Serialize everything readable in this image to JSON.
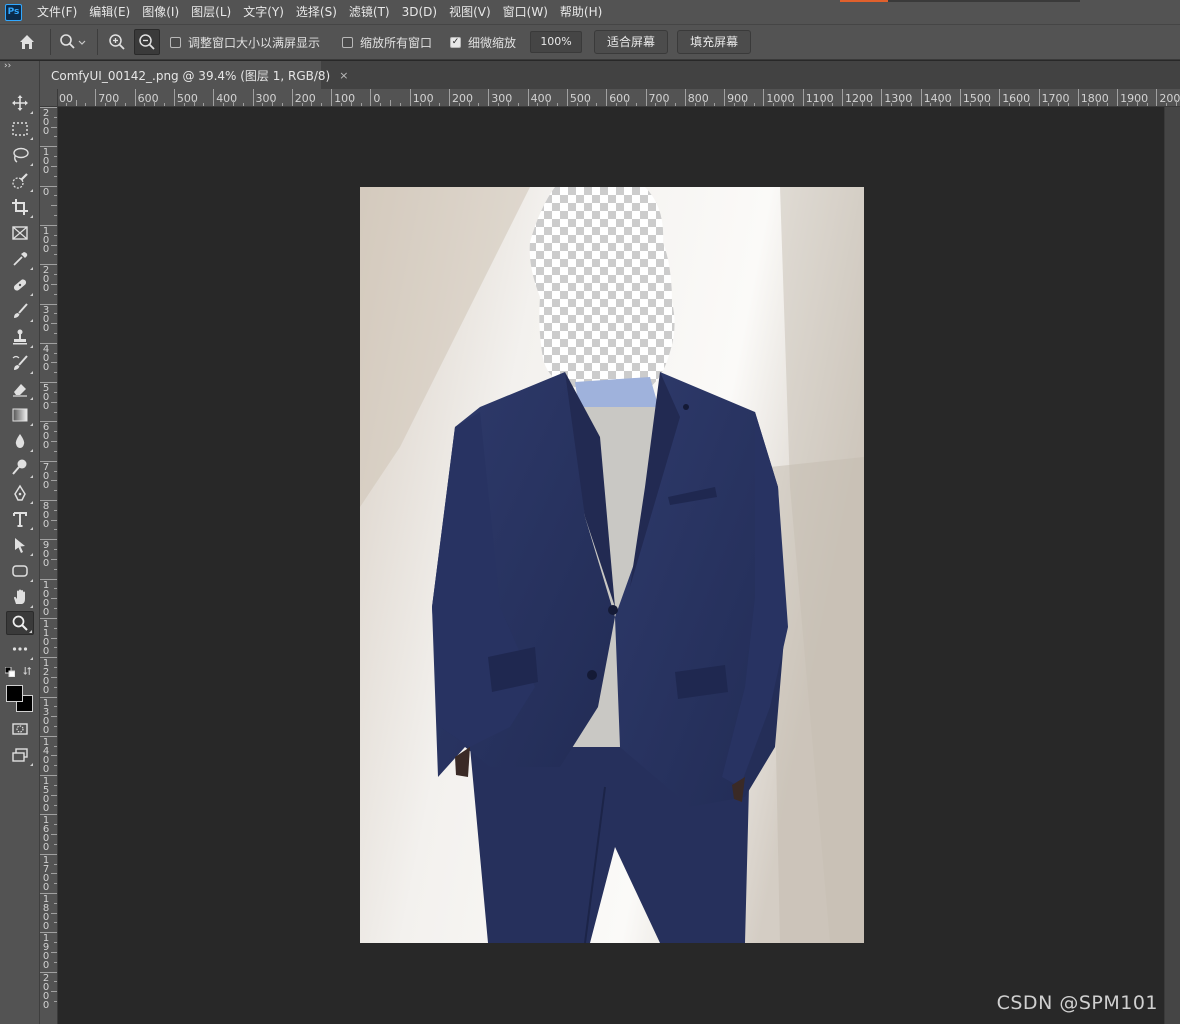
{
  "app": {
    "logo_text": "Ps"
  },
  "menu": [
    "文件(F)",
    "编辑(E)",
    "图像(I)",
    "图层(L)",
    "文字(Y)",
    "选择(S)",
    "滤镜(T)",
    "3D(D)",
    "视图(V)",
    "窗口(W)",
    "帮助(H)"
  ],
  "options": {
    "resize_windows_label": "调整窗口大小以满屏显示",
    "resize_windows_checked": false,
    "zoom_all_label": "缩放所有窗口",
    "zoom_all_checked": false,
    "scrubby_label": "细微缩放",
    "scrubby_checked": true,
    "zoom_value": "100%",
    "fit_screen_label": "适合屏幕",
    "fill_screen_label": "填充屏幕"
  },
  "document": {
    "tab_title": "ComfyUI_00142_.png @ 39.4% (图层 1, RGB/8)",
    "close_glyph": "×"
  },
  "ruler": {
    "top_labels": [
      "00",
      "700",
      "600",
      "500",
      "400",
      "300",
      "200",
      "100",
      "0",
      "100",
      "200",
      "300",
      "400",
      "500",
      "600",
      "700",
      "800",
      "900",
      "1000",
      "1100",
      "1200",
      "1300",
      "1400",
      "1500",
      "1600",
      "1700",
      "1800",
      "1900",
      "200"
    ],
    "left_labels": [
      "200",
      "100",
      "0",
      "100",
      "200",
      "300",
      "400",
      "500",
      "600",
      "700",
      "800",
      "900",
      "1000",
      "1100",
      "1200",
      "1300",
      "1400",
      "1500",
      "1600",
      "1700",
      "1800",
      "1900",
      "2000"
    ]
  },
  "toolbar": {
    "collapse_glyph": "››",
    "tools": [
      "move",
      "marquee",
      "lasso",
      "quick-select",
      "crop",
      "frame",
      "eyedropper",
      "healing",
      "brush",
      "stamp",
      "history-brush",
      "eraser",
      "gradient",
      "blur",
      "dodge",
      "pen",
      "type",
      "path-select",
      "shape",
      "hand",
      "zoom",
      "more"
    ],
    "active_tool": "zoom",
    "foreground_color": "#000000",
    "background_color": "#000000"
  },
  "colors": {
    "panel": "#535353",
    "canvas": "#282828",
    "suit": "#2a3563",
    "sweater": "#c9c8c4",
    "wall": "#e8e4de"
  },
  "watermark": "CSDN @SPM101"
}
